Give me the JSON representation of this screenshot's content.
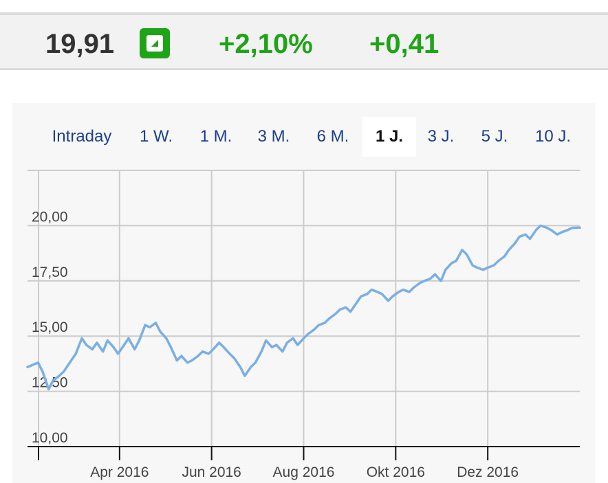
{
  "quote": {
    "price": "19,91",
    "change_percent": "+2,10%",
    "change_abs": "+0,41",
    "trend_icon": "arrow-up-right-icon",
    "positive_color": "#1fa317"
  },
  "tabs": [
    {
      "label": "Intraday"
    },
    {
      "label": "1 W."
    },
    {
      "label": "1 M."
    },
    {
      "label": "3 M."
    },
    {
      "label": "6 M."
    },
    {
      "label": "1 J.",
      "active": true
    },
    {
      "label": "3 J."
    },
    {
      "label": "5 J."
    },
    {
      "label": "10 J."
    }
  ],
  "chart_data": {
    "type": "line",
    "line_color": "#7aafe3",
    "y_ticks": [
      "10,00",
      "12,50",
      "15,00",
      "17,50",
      "20,00"
    ],
    "y_tick_values": [
      10,
      12.5,
      15,
      17.5,
      20
    ],
    "ylim": [
      10,
      22.5
    ],
    "x_ticks": [
      "Apr 2016",
      "Jun 2016",
      "Aug 2016",
      "Okt 2016",
      "Dez 2016"
    ],
    "x_tick_values": [
      "2016-04-01",
      "2016-06-01",
      "2016-08-01",
      "2016-10-01",
      "2016-12-01"
    ],
    "xlim": [
      "2016-01-31",
      "2017-01-31"
    ],
    "grid": true,
    "series": [
      {
        "x": [
          "2016-01-31",
          "2016-02-07",
          "2016-02-10",
          "2016-02-14",
          "2016-02-17",
          "2016-02-21",
          "2016-02-24",
          "2016-02-28",
          "2016-03-03",
          "2016-03-07",
          "2016-03-10",
          "2016-03-14",
          "2016-03-17",
          "2016-03-21",
          "2016-03-24",
          "2016-03-28",
          "2016-03-31",
          "2016-04-04",
          "2016-04-07",
          "2016-04-11",
          "2016-04-14",
          "2016-04-18",
          "2016-04-21",
          "2016-04-25",
          "2016-04-28",
          "2016-05-02",
          "2016-05-05",
          "2016-05-09",
          "2016-05-12",
          "2016-05-16",
          "2016-05-19",
          "2016-05-23",
          "2016-05-26",
          "2016-05-30",
          "2016-06-02",
          "2016-06-06",
          "2016-06-09",
          "2016-06-13",
          "2016-06-16",
          "2016-06-20",
          "2016-06-23",
          "2016-06-27",
          "2016-06-30",
          "2016-07-04",
          "2016-07-07",
          "2016-07-11",
          "2016-07-14",
          "2016-07-18",
          "2016-07-21",
          "2016-07-25",
          "2016-07-28",
          "2016-08-01",
          "2016-08-04",
          "2016-08-08",
          "2016-08-11",
          "2016-08-15",
          "2016-08-18",
          "2016-08-22",
          "2016-08-25",
          "2016-08-29",
          "2016-09-01",
          "2016-09-05",
          "2016-09-08",
          "2016-09-12",
          "2016-09-15",
          "2016-09-19",
          "2016-09-22",
          "2016-09-26",
          "2016-09-29",
          "2016-10-03",
          "2016-10-06",
          "2016-10-10",
          "2016-10-13",
          "2016-10-17",
          "2016-10-20",
          "2016-10-24",
          "2016-10-27",
          "2016-10-31",
          "2016-11-03",
          "2016-11-07",
          "2016-11-10",
          "2016-11-14",
          "2016-11-17",
          "2016-11-21",
          "2016-11-24",
          "2016-11-28",
          "2016-12-01",
          "2016-12-05",
          "2016-12-08",
          "2016-12-12",
          "2016-12-15",
          "2016-12-19",
          "2016-12-22",
          "2016-12-26",
          "2016-12-29",
          "2017-01-02",
          "2017-01-05",
          "2017-01-09",
          "2017-01-12",
          "2017-01-16",
          "2017-01-19",
          "2017-01-23",
          "2017-01-26",
          "2017-01-31"
        ],
        "values": [
          13.6,
          13.8,
          13.4,
          12.6,
          13.0,
          13.2,
          13.4,
          13.8,
          14.2,
          14.9,
          14.6,
          14.4,
          14.7,
          14.3,
          14.8,
          14.5,
          14.2,
          14.6,
          14.9,
          14.4,
          14.8,
          15.5,
          15.4,
          15.6,
          15.2,
          14.9,
          14.5,
          13.9,
          14.1,
          13.8,
          13.9,
          14.1,
          14.3,
          14.2,
          14.4,
          14.7,
          14.5,
          14.2,
          14.0,
          13.6,
          13.2,
          13.6,
          13.8,
          14.3,
          14.8,
          14.5,
          14.6,
          14.3,
          14.7,
          14.9,
          14.6,
          14.9,
          15.1,
          15.3,
          15.5,
          15.6,
          15.8,
          16.0,
          16.2,
          16.3,
          16.1,
          16.5,
          16.8,
          16.9,
          17.1,
          17.0,
          16.9,
          16.6,
          16.8,
          17.0,
          17.1,
          17.0,
          17.2,
          17.4,
          17.5,
          17.6,
          17.8,
          17.5,
          18.0,
          18.3,
          18.4,
          18.9,
          18.7,
          18.2,
          18.1,
          18.0,
          18.1,
          18.2,
          18.4,
          18.6,
          18.9,
          19.2,
          19.5,
          19.6,
          19.4,
          19.8,
          20.0,
          19.91,
          19.8,
          19.6,
          19.7,
          19.8,
          19.9,
          19.91
        ]
      }
    ]
  }
}
